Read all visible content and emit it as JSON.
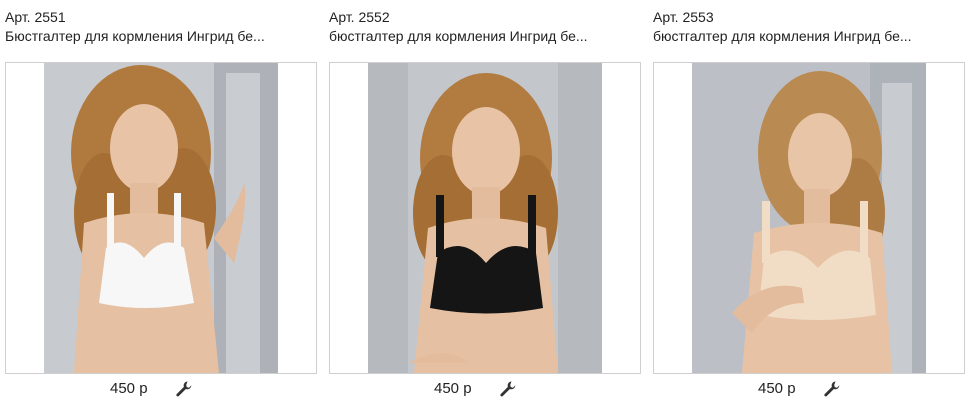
{
  "products": [
    {
      "article": "Арт. 2551",
      "title": "Бюстгалтер для кормления Ингрид бе...",
      "price": "450 р",
      "bra_color": "#f7f7f7",
      "icon": "wrench-icon"
    },
    {
      "article": "Арт. 2552",
      "title": "бюстгалтер для кормления Ингрид бе...",
      "price": "450 р",
      "bra_color": "#151515",
      "icon": "wrench-icon"
    },
    {
      "article": "Арт. 2553",
      "title": "бюстгалтер для кормления Ингрид бе...",
      "price": "450 р",
      "bra_color": "#f1dcc6",
      "icon": "wrench-icon"
    }
  ]
}
